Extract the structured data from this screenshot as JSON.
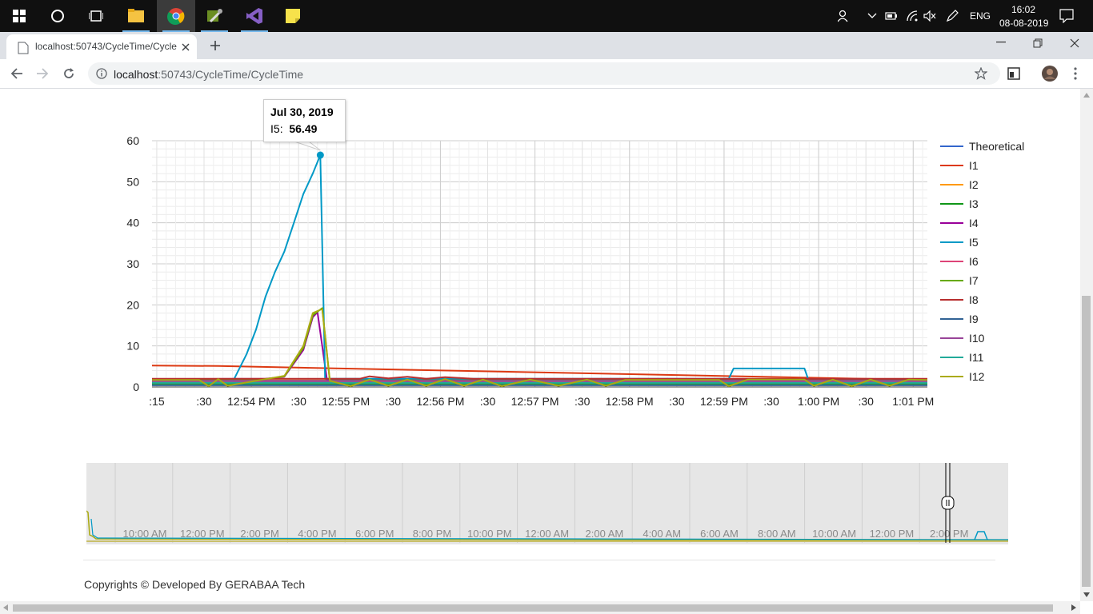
{
  "taskbar": {
    "icons": [
      "windows-start-icon",
      "cortana-icon",
      "task-view-icon",
      "file-explorer-icon",
      "chrome-icon",
      "tools-icon",
      "visual-studio-icon",
      "sticky-notes-icon"
    ],
    "lang": "ENG",
    "time": "16:02",
    "date": "08-08-2019"
  },
  "browser": {
    "tab_title": "localhost:50743/CycleTime/Cycle",
    "url_host": "localhost",
    "url_rest": ":50743/CycleTime/CycleTime"
  },
  "chart_data": {
    "type": "line",
    "y_ticks": [
      "60",
      "50",
      "40",
      "30",
      "20",
      "10",
      "0"
    ],
    "ylim": [
      0,
      60
    ],
    "x_ticks": [
      ":15",
      ":30",
      "12:54 PM",
      ":30",
      "12:55 PM",
      ":30",
      "12:56 PM",
      ":30",
      "12:57 PM",
      ":30",
      "12:58 PM",
      ":30",
      "12:59 PM",
      ":30",
      "1:00 PM",
      ":30",
      "1:01 PM"
    ],
    "x_unit": "minutes after 12:00 PM",
    "xlim": [
      53.2,
      61.4
    ],
    "grid": true,
    "legend_position": "right",
    "series": [
      {
        "name": "Theoretical",
        "color": "#3366cc",
        "points": [
          [
            53.2,
            1.2
          ],
          [
            61.4,
            1.2
          ]
        ]
      },
      {
        "name": "I1",
        "color": "#dc3912",
        "points": [
          [
            53.2,
            5.2
          ],
          [
            53.9,
            5.1
          ],
          [
            61.4,
            1.7
          ]
        ]
      },
      {
        "name": "I2",
        "color": "#ff9900",
        "points": [
          [
            53.2,
            1.6
          ],
          [
            61.4,
            1.6
          ]
        ]
      },
      {
        "name": "I3",
        "color": "#109618",
        "points": [
          [
            53.2,
            0.8
          ],
          [
            61.4,
            0.8
          ]
        ]
      },
      {
        "name": "I4",
        "color": "#990099",
        "points": [
          [
            53.2,
            1.9
          ],
          [
            54.4,
            2.0
          ],
          [
            54.6,
            2.5
          ],
          [
            54.8,
            9
          ],
          [
            54.9,
            17
          ],
          [
            54.95,
            18.2
          ],
          [
            55.05,
            1.8
          ],
          [
            61.4,
            1.8
          ]
        ]
      },
      {
        "name": "I5",
        "color": "#0099c6",
        "points": [
          [
            53.2,
            1.1
          ],
          [
            54.05,
            1.1
          ],
          [
            54.2,
            8
          ],
          [
            54.3,
            14
          ],
          [
            54.4,
            22
          ],
          [
            54.5,
            28
          ],
          [
            54.6,
            33
          ],
          [
            54.7,
            40
          ],
          [
            54.8,
            47
          ],
          [
            54.9,
            52
          ],
          [
            54.98,
            56.49
          ],
          [
            55.03,
            2
          ],
          [
            59.3,
            2
          ],
          [
            59.35,
            4.5
          ],
          [
            60.1,
            4.5
          ],
          [
            60.15,
            1.2
          ],
          [
            61.4,
            1.2
          ]
        ]
      },
      {
        "name": "I6",
        "color": "#dd4477",
        "points": [
          [
            53.2,
            1.4
          ],
          [
            61.4,
            1.4
          ]
        ]
      },
      {
        "name": "I7",
        "color": "#66aa00",
        "points": [
          [
            53.2,
            1.8
          ],
          [
            54.4,
            1.9
          ],
          [
            54.6,
            2.6
          ],
          [
            54.8,
            9.5
          ],
          [
            54.9,
            17.5
          ],
          [
            55.0,
            19.2
          ],
          [
            55.08,
            1.6
          ],
          [
            61.4,
            1.6
          ]
        ]
      },
      {
        "name": "I8",
        "color": "#b82e2e",
        "points": [
          [
            53.2,
            2.0
          ],
          [
            55.4,
            2.0
          ],
          [
            55.5,
            2.6
          ],
          [
            55.7,
            2.1
          ],
          [
            55.9,
            2.5
          ],
          [
            56.1,
            2.0
          ],
          [
            56.3,
            2.4
          ],
          [
            56.6,
            2.0
          ],
          [
            61.4,
            2.0
          ]
        ]
      },
      {
        "name": "I9",
        "color": "#316395",
        "points": [
          [
            53.2,
            0.4
          ],
          [
            61.4,
            0.4
          ]
        ]
      },
      {
        "name": "I10",
        "color": "#994499",
        "points": [
          [
            53.2,
            1.5
          ],
          [
            61.4,
            1.5
          ]
        ]
      },
      {
        "name": "I11",
        "color": "#22aa99",
        "points": [
          [
            53.2,
            1.0
          ],
          [
            61.4,
            1.0
          ]
        ]
      },
      {
        "name": "I12",
        "color": "#aaaa11",
        "points": [
          [
            53.2,
            1.7
          ],
          [
            53.7,
            1.7
          ],
          [
            53.8,
            0.2
          ],
          [
            53.9,
            1.9
          ],
          [
            54.0,
            0.3
          ],
          [
            54.4,
            1.9
          ],
          [
            54.6,
            2.7
          ],
          [
            54.8,
            10
          ],
          [
            54.9,
            18
          ],
          [
            55.0,
            19
          ],
          [
            55.08,
            1.5
          ],
          [
            55.3,
            0.2
          ],
          [
            55.5,
            1.8
          ],
          [
            55.7,
            0.3
          ],
          [
            55.9,
            1.8
          ],
          [
            56.1,
            0.3
          ],
          [
            56.3,
            1.9
          ],
          [
            56.5,
            0.3
          ],
          [
            56.7,
            1.8
          ],
          [
            56.9,
            0.2
          ],
          [
            57.2,
            1.8
          ],
          [
            57.5,
            0.3
          ],
          [
            57.8,
            1.8
          ],
          [
            58.0,
            0.3
          ],
          [
            58.2,
            1.7
          ],
          [
            59.2,
            1.7
          ],
          [
            59.3,
            0.2
          ],
          [
            59.5,
            1.8
          ],
          [
            60.1,
            1.8
          ],
          [
            60.2,
            0.3
          ],
          [
            60.4,
            1.8
          ],
          [
            60.6,
            0.2
          ],
          [
            60.8,
            1.8
          ],
          [
            61.0,
            0.3
          ],
          [
            61.2,
            1.8
          ],
          [
            61.4,
            1.7
          ]
        ]
      }
    ],
    "tooltip": {
      "date": "Jul 30, 2019",
      "series": "I5",
      "value": "56.49",
      "x": 54.98,
      "y": 56.49
    }
  },
  "range_selector": {
    "labels": [
      "10:00 AM",
      "12:00 PM",
      "2:00 PM",
      "4:00 PM",
      "6:00 PM",
      "8:00 PM",
      "10:00 PM",
      "12:00 AM",
      "2:00 AM",
      "4:00 AM",
      "6:00 AM",
      "8:00 AM",
      "10:00 AM",
      "12:00 PM",
      "2:00 PM"
    ]
  },
  "footer": {
    "copyright": "Copyrights © Developed By GERABAA Tech"
  }
}
